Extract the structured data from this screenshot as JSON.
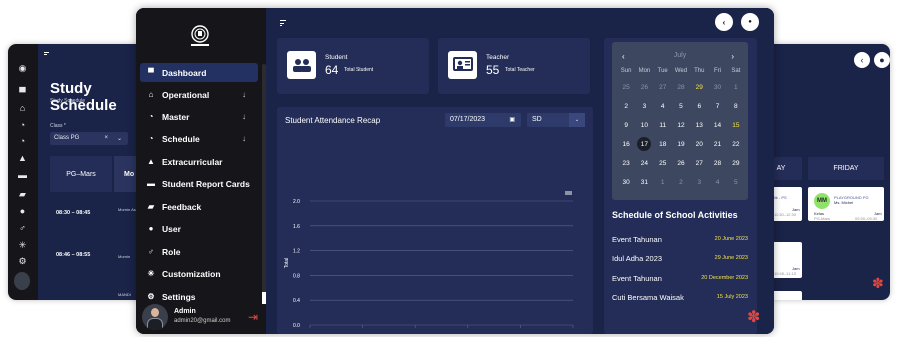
{
  "bg_left": {
    "title": "Study Schedule",
    "subtitle": "Study Schedule",
    "class_label": "Class *",
    "class_value": "Class PG",
    "clear_glyph": "×",
    "caret_glyph": "⌄",
    "pg_header": "PG–Mars",
    "mo_header": "Mo",
    "times": [
      "08:30 – 08:45",
      "08:46 – 08:55"
    ],
    "cells": [
      "Mornin Assem",
      "Mornin",
      "MANDI"
    ]
  },
  "bg_right": {
    "day_left": "AY",
    "day_right": "FRIDAY",
    "badge": "MM",
    "card_title": "PLAYGROUND PG",
    "card_teacher": "Ms. Michel",
    "card_kelas": "Kelas",
    "card_jam": "Jam",
    "card_class": "PG-Mars",
    "card_time": "09:30–09:30",
    "left_card_title": "lik - PS",
    "left_card_jam": "Jam",
    "left_card_time": "11:30–12:30",
    "lower_jam": "Jam",
    "lower_time": "10:45–11:15"
  },
  "sidebar": {
    "items": [
      {
        "label": "Dashboard",
        "icon": "dashboard-icon",
        "glyph": "▀",
        "chevron": false
      },
      {
        "label": "Operational",
        "icon": "building-icon",
        "glyph": "⌂",
        "chevron": true
      },
      {
        "label": "Master",
        "icon": "pie-icon",
        "glyph": "◔",
        "chevron": true
      },
      {
        "label": "Schedule",
        "icon": "schedule-icon",
        "glyph": "◔",
        "chevron": true
      },
      {
        "label": "Extracurricular",
        "icon": "extracurricular-icon",
        "glyph": "▲",
        "chevron": false
      },
      {
        "label": "Student Report Cards",
        "icon": "report-icon",
        "glyph": "▬",
        "chevron": false
      },
      {
        "label": "Feedback",
        "icon": "feedback-icon",
        "glyph": "▰",
        "chevron": false
      },
      {
        "label": "User",
        "icon": "user-icon",
        "glyph": "●",
        "chevron": false
      },
      {
        "label": "Role",
        "icon": "role-icon",
        "glyph": "♂",
        "chevron": false
      },
      {
        "label": "Customization",
        "icon": "magic-icon",
        "glyph": "✳",
        "chevron": false
      },
      {
        "label": "Settings",
        "icon": "gear-icon",
        "glyph": "⚙",
        "chevron": false
      }
    ],
    "chevron_glyph": "↓",
    "admin_name": "Admin",
    "admin_email": "admin20@gmail.com"
  },
  "header": {
    "back_glyph": "‹",
    "bell_glyph": "●"
  },
  "stats": [
    {
      "label": "Student",
      "value": "64",
      "sub": "Total Student",
      "icon": "students-icon"
    },
    {
      "label": "Teacher",
      "value": "55",
      "sub": "Total Teacher",
      "icon": "teacher-icon"
    }
  ],
  "attendance": {
    "title": "Student Attendance Recap",
    "date": "07/17/2023",
    "class": "SD",
    "calendar_glyph": "▣",
    "dropdown_glyph": "⌄"
  },
  "chart_data": {
    "type": "line",
    "title": "",
    "xlabel": "",
    "ylabel": "Total",
    "yticks": [
      "2.0",
      "1.6",
      "1.2",
      "0.8",
      "0.4",
      "0.0"
    ],
    "ylim": [
      0,
      2.0
    ],
    "series": [],
    "grid": true
  },
  "calendar": {
    "month": "July",
    "prev_glyph": "‹",
    "next_glyph": "›",
    "weekdays": [
      "Sun",
      "Mon",
      "Tue",
      "Wed",
      "Thu",
      "Fri",
      "Sat"
    ],
    "weeks": [
      [
        {
          "d": "25",
          "s": "dim"
        },
        {
          "d": "26",
          "s": "dim"
        },
        {
          "d": "27",
          "s": "dim"
        },
        {
          "d": "28",
          "s": "dim"
        },
        {
          "d": "29",
          "s": "yellow"
        },
        {
          "d": "30",
          "s": "dim"
        },
        {
          "d": "1",
          "s": "dim"
        }
      ],
      [
        {
          "d": "2",
          "s": ""
        },
        {
          "d": "3",
          "s": ""
        },
        {
          "d": "4",
          "s": ""
        },
        {
          "d": "5",
          "s": ""
        },
        {
          "d": "6",
          "s": ""
        },
        {
          "d": "7",
          "s": ""
        },
        {
          "d": "8",
          "s": ""
        }
      ],
      [
        {
          "d": "9",
          "s": ""
        },
        {
          "d": "10",
          "s": ""
        },
        {
          "d": "11",
          "s": ""
        },
        {
          "d": "12",
          "s": ""
        },
        {
          "d": "13",
          "s": ""
        },
        {
          "d": "14",
          "s": ""
        },
        {
          "d": "15",
          "s": "yellow"
        }
      ],
      [
        {
          "d": "16",
          "s": ""
        },
        {
          "d": "17",
          "s": "today"
        },
        {
          "d": "18",
          "s": ""
        },
        {
          "d": "19",
          "s": ""
        },
        {
          "d": "20",
          "s": ""
        },
        {
          "d": "21",
          "s": ""
        },
        {
          "d": "22",
          "s": ""
        }
      ],
      [
        {
          "d": "23",
          "s": ""
        },
        {
          "d": "24",
          "s": ""
        },
        {
          "d": "25",
          "s": ""
        },
        {
          "d": "26",
          "s": ""
        },
        {
          "d": "27",
          "s": ""
        },
        {
          "d": "28",
          "s": ""
        },
        {
          "d": "29",
          "s": ""
        }
      ],
      [
        {
          "d": "30",
          "s": ""
        },
        {
          "d": "31",
          "s": ""
        },
        {
          "d": "1",
          "s": "dim"
        },
        {
          "d": "2",
          "s": "dim"
        },
        {
          "d": "3",
          "s": "dim"
        },
        {
          "d": "4",
          "s": "dim"
        },
        {
          "d": "5",
          "s": "dim"
        }
      ]
    ]
  },
  "activities": {
    "title": "Schedule of School Activities",
    "items": [
      {
        "name": "Event Tahunan",
        "date": "20 June 2023"
      },
      {
        "name": "Idul Adha 2023",
        "date": "29 June 2023"
      },
      {
        "name": "Event Tahunan",
        "date": "20 December 2023"
      },
      {
        "name": "Cuti Bersama Waisak",
        "date": "15 July 2023"
      }
    ]
  },
  "colors": {
    "dark": "#16161a",
    "navy": "#1a2348",
    "card": "#232d57",
    "accent_yellow": "#f5e24a",
    "logout_red": "#e4473e"
  }
}
